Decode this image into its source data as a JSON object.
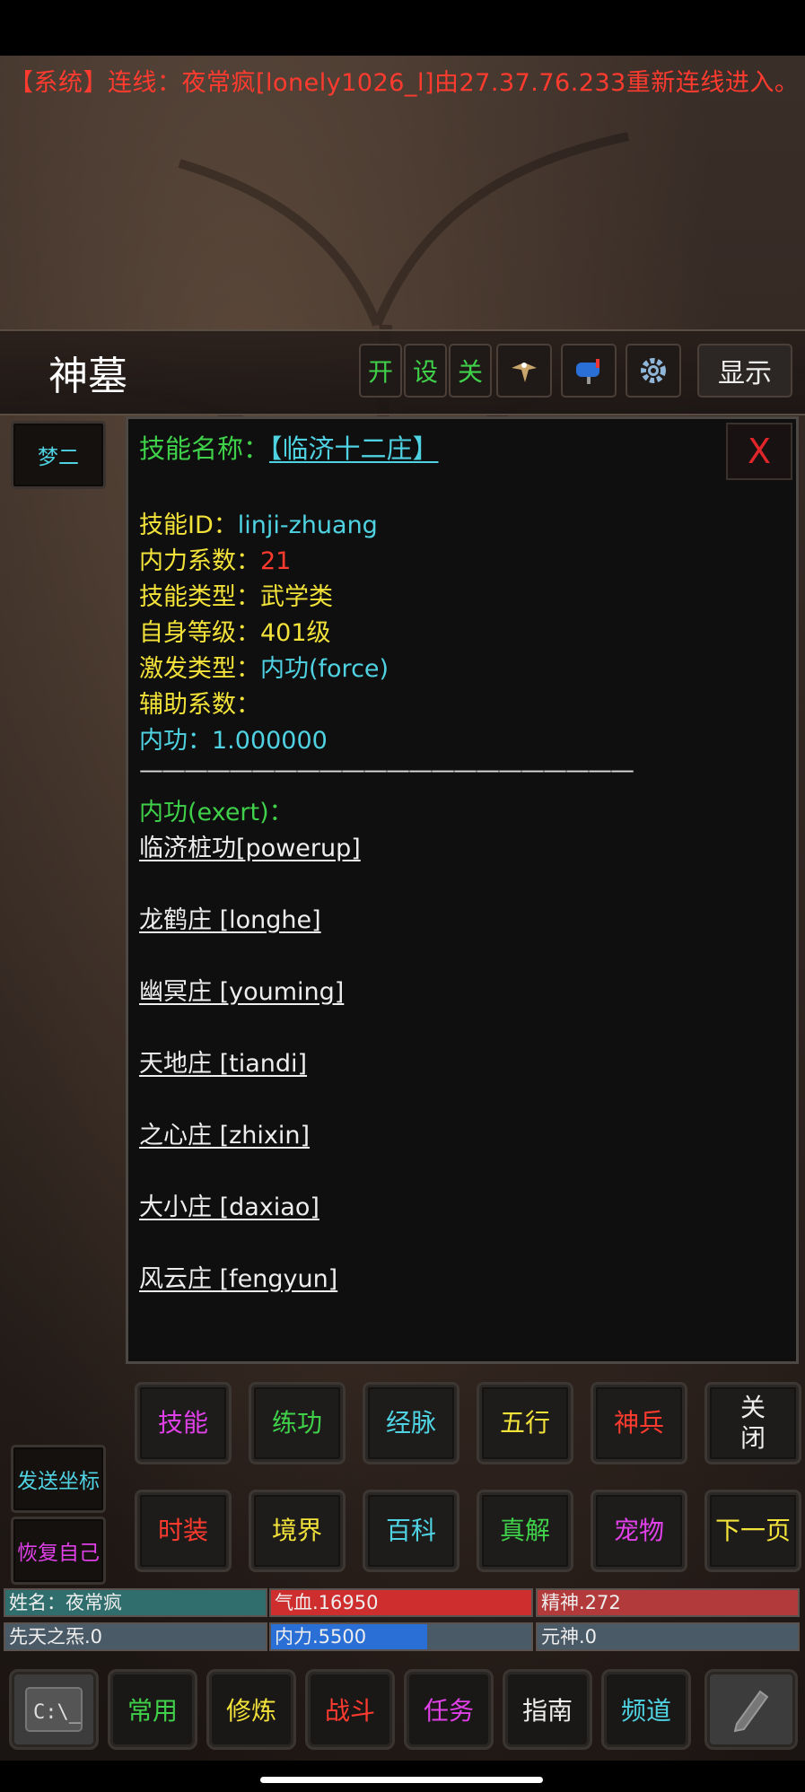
{
  "system_message": "【系统】连线：夜常疯[lonely1026_l]由27.37.76.233重新连线进入。",
  "room": "神墓",
  "toolbar": {
    "open": "开",
    "settings": "设",
    "close": "关",
    "show": "显示"
  },
  "side": {
    "top_button": "梦二",
    "send_coords": "发送坐标",
    "restore_self": "恢复自己"
  },
  "skill": {
    "title_label": "技能名称：",
    "title_value": "【临济十二庄】",
    "close": "X",
    "id_label": "技能ID：",
    "id_value": "linji-zhuang",
    "neili_label": "内力系数：",
    "neili_value": "21",
    "type_label": "技能类型：",
    "type_value": "武学类",
    "level_label": "自身等级：",
    "level_value": "401级",
    "exert_type_label": "激发类型：",
    "exert_type_value": "内功(force)",
    "aux_label": "辅助系数：",
    "force_label": "内功：",
    "force_value": "1.000000",
    "divider": "——————————————————————",
    "exert_header": "内功(exert)：",
    "exerts": [
      "临济桩功[powerup]",
      "龙鹤庄 [longhe]",
      "幽冥庄 [youming]",
      "天地庄 [tiandi]",
      "之心庄 [zhixin]",
      "大小庄 [daxiao]",
      "风云庄 [fengyun]"
    ]
  },
  "grid_row1": [
    "技能",
    "练功",
    "经脉",
    "五行",
    "神兵",
    "关\n闭"
  ],
  "grid_row2": [
    "时装",
    "境界",
    "百科",
    "真解",
    "宠物",
    "下一页"
  ],
  "stats": {
    "name": "姓名：夜常疯",
    "hp": "气血.16950",
    "hp_fraction": 1.0,
    "spirit": "精神.272",
    "spirit_fraction": 1.0,
    "xiantian": "先天之炁.0",
    "neili": "内力.5500",
    "neili_fraction": 0.6,
    "yuanshen": "元神.0"
  },
  "bottom_nav": [
    "常用",
    "修炼",
    "战斗",
    "任务",
    "指南",
    "频道"
  ],
  "colors": {
    "red": "#ff3b2f",
    "green": "#3fd14a",
    "yellow": "#f2e23a",
    "cyan": "#4fd3e3",
    "magenta": "#e040e8"
  }
}
